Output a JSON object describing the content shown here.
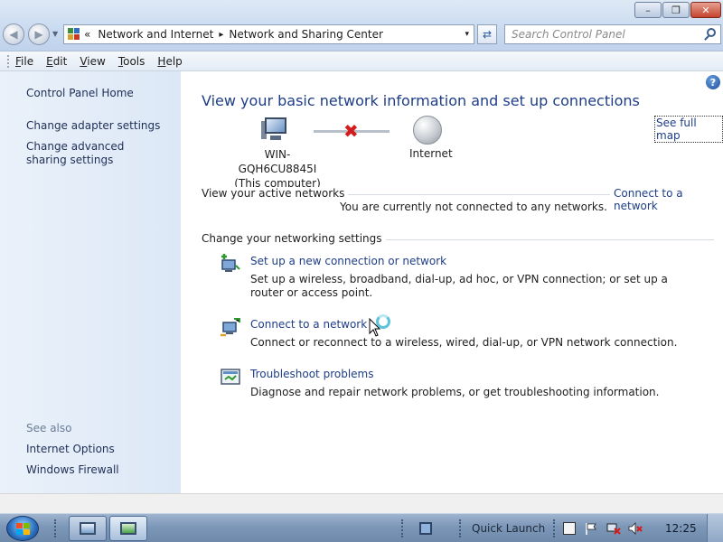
{
  "window": {
    "caption_buttons": {
      "minimize": "–",
      "maximize": "❐",
      "close": "✕"
    }
  },
  "address_bar": {
    "overflow_marker": "«",
    "breadcrumbs": [
      "Network and Internet",
      "Network and Sharing Center"
    ],
    "separator": "▸",
    "dropdown_icon": "▾",
    "refresh_icon": "⇄"
  },
  "search": {
    "placeholder": "Search Control Panel"
  },
  "menu": {
    "items": [
      "File",
      "Edit",
      "View",
      "Tools",
      "Help"
    ]
  },
  "sidebar": {
    "home": "Control Panel Home",
    "links": [
      "Change adapter settings",
      "Change advanced sharing settings"
    ],
    "see_also_heading": "See also",
    "see_also": [
      "Internet Options",
      "Windows Firewall"
    ]
  },
  "main": {
    "help_icon": "?",
    "title": "View your basic network information and set up connections",
    "see_full_map": "See full map",
    "network_map": {
      "computer_name": "WIN-GQH6CU8845I",
      "computer_sub": "(This computer)",
      "link_status_icon": "✖",
      "internet_label": "Internet"
    },
    "active_networks": {
      "heading": "View your active networks",
      "action": "Connect to a network",
      "status": "You are currently not connected to any networks."
    },
    "settings": {
      "heading": "Change your networking settings",
      "tasks": [
        {
          "link": "Set up a new connection or network",
          "desc": "Set up a wireless, broadband, dial-up, ad hoc, or VPN connection; or set up a router or access point."
        },
        {
          "link": "Connect to a network",
          "desc": "Connect or reconnect to a wireless, wired, dial-up, or VPN network connection."
        },
        {
          "link": "Troubleshoot problems",
          "desc": "Diagnose and repair network problems, or get troubleshooting information."
        }
      ]
    }
  },
  "taskbar": {
    "quick_launch": "Quick Launch",
    "clock": "12:25"
  },
  "colors": {
    "link": "#1e3d87",
    "error_x": "#d41c1c",
    "sidebar_bg": "#dce8f6",
    "taskbar": "#7d97b8"
  }
}
